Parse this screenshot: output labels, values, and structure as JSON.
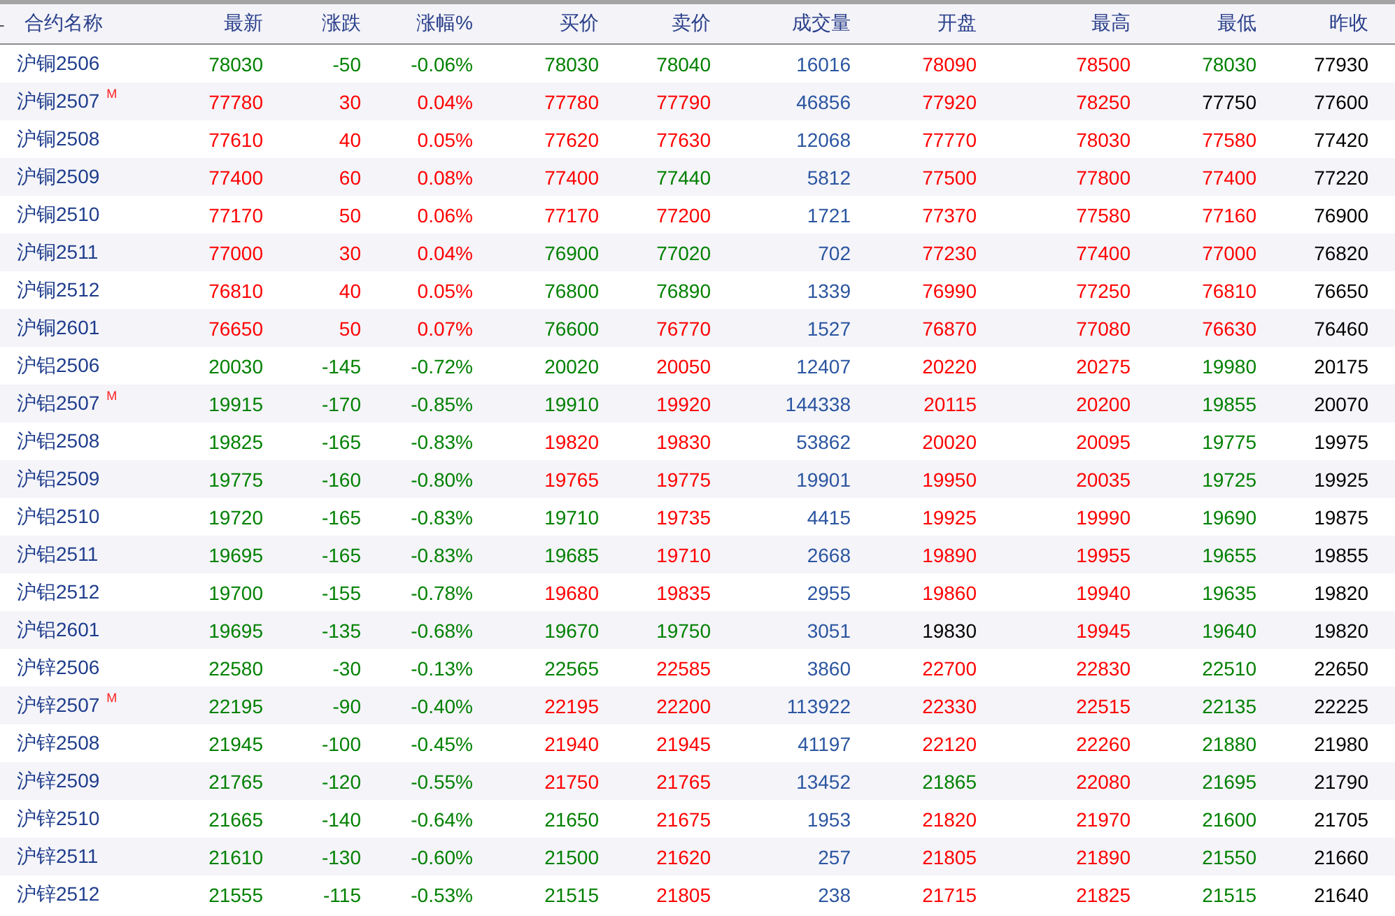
{
  "collapse_toggle": "-",
  "columns": [
    "合约名称",
    "最新",
    "涨跌",
    "涨幅%",
    "买价",
    "卖价",
    "成交量",
    "开盘",
    "最高",
    "最低",
    "昨收"
  ],
  "rows": [
    {
      "name": "沪铜2506",
      "cells": [
        {
          "text": "78030",
          "color": "#008000"
        },
        {
          "text": "-50",
          "color": "#008000"
        },
        {
          "text": "-0.06%",
          "color": "#008000"
        },
        {
          "text": "78030",
          "color": "#008000"
        },
        {
          "text": "78040",
          "color": "#008000"
        },
        {
          "text": "16016",
          "color": "#2b55a0"
        },
        {
          "text": "78090",
          "color": "#ff0000"
        },
        {
          "text": "78500",
          "color": "#ff0000"
        },
        {
          "text": "78030",
          "color": "#008000"
        },
        {
          "text": "77930",
          "color": "#000000"
        }
      ]
    },
    {
      "name": "沪铜2507",
      "mark": "M",
      "cells": [
        {
          "text": "77780",
          "color": "#ff0000"
        },
        {
          "text": "30",
          "color": "#ff0000"
        },
        {
          "text": "0.04%",
          "color": "#ff0000"
        },
        {
          "text": "77780",
          "color": "#ff0000"
        },
        {
          "text": "77790",
          "color": "#ff0000"
        },
        {
          "text": "46856",
          "color": "#2b55a0"
        },
        {
          "text": "77920",
          "color": "#ff0000"
        },
        {
          "text": "78250",
          "color": "#ff0000"
        },
        {
          "text": "77750",
          "color": "#000000"
        },
        {
          "text": "77600",
          "color": "#000000"
        }
      ]
    },
    {
      "name": "沪铜2508",
      "cells": [
        {
          "text": "77610",
          "color": "#ff0000"
        },
        {
          "text": "40",
          "color": "#ff0000"
        },
        {
          "text": "0.05%",
          "color": "#ff0000"
        },
        {
          "text": "77620",
          "color": "#ff0000"
        },
        {
          "text": "77630",
          "color": "#ff0000"
        },
        {
          "text": "12068",
          "color": "#2b55a0"
        },
        {
          "text": "77770",
          "color": "#ff0000"
        },
        {
          "text": "78030",
          "color": "#ff0000"
        },
        {
          "text": "77580",
          "color": "#ff0000"
        },
        {
          "text": "77420",
          "color": "#000000"
        }
      ]
    },
    {
      "name": "沪铜2509",
      "cells": [
        {
          "text": "77400",
          "color": "#ff0000"
        },
        {
          "text": "60",
          "color": "#ff0000"
        },
        {
          "text": "0.08%",
          "color": "#ff0000"
        },
        {
          "text": "77400",
          "color": "#ff0000"
        },
        {
          "text": "77440",
          "color": "#008000"
        },
        {
          "text": "5812",
          "color": "#2b55a0"
        },
        {
          "text": "77500",
          "color": "#ff0000"
        },
        {
          "text": "77800",
          "color": "#ff0000"
        },
        {
          "text": "77400",
          "color": "#ff0000"
        },
        {
          "text": "77220",
          "color": "#000000"
        }
      ]
    },
    {
      "name": "沪铜2510",
      "cells": [
        {
          "text": "77170",
          "color": "#ff0000"
        },
        {
          "text": "50",
          "color": "#ff0000"
        },
        {
          "text": "0.06%",
          "color": "#ff0000"
        },
        {
          "text": "77170",
          "color": "#ff0000"
        },
        {
          "text": "77200",
          "color": "#ff0000"
        },
        {
          "text": "1721",
          "color": "#2b55a0"
        },
        {
          "text": "77370",
          "color": "#ff0000"
        },
        {
          "text": "77580",
          "color": "#ff0000"
        },
        {
          "text": "77160",
          "color": "#ff0000"
        },
        {
          "text": "76900",
          "color": "#000000"
        }
      ]
    },
    {
      "name": "沪铜2511",
      "cells": [
        {
          "text": "77000",
          "color": "#ff0000"
        },
        {
          "text": "30",
          "color": "#ff0000"
        },
        {
          "text": "0.04%",
          "color": "#ff0000"
        },
        {
          "text": "76900",
          "color": "#008000"
        },
        {
          "text": "77020",
          "color": "#008000"
        },
        {
          "text": "702",
          "color": "#2b55a0"
        },
        {
          "text": "77230",
          "color": "#ff0000"
        },
        {
          "text": "77400",
          "color": "#ff0000"
        },
        {
          "text": "77000",
          "color": "#ff0000"
        },
        {
          "text": "76820",
          "color": "#000000"
        }
      ]
    },
    {
      "name": "沪铜2512",
      "cells": [
        {
          "text": "76810",
          "color": "#ff0000"
        },
        {
          "text": "40",
          "color": "#ff0000"
        },
        {
          "text": "0.05%",
          "color": "#ff0000"
        },
        {
          "text": "76800",
          "color": "#008000"
        },
        {
          "text": "76890",
          "color": "#008000"
        },
        {
          "text": "1339",
          "color": "#2b55a0"
        },
        {
          "text": "76990",
          "color": "#ff0000"
        },
        {
          "text": "77250",
          "color": "#ff0000"
        },
        {
          "text": "76810",
          "color": "#ff0000"
        },
        {
          "text": "76650",
          "color": "#000000"
        }
      ]
    },
    {
      "name": "沪铜2601",
      "cells": [
        {
          "text": "76650",
          "color": "#ff0000"
        },
        {
          "text": "50",
          "color": "#ff0000"
        },
        {
          "text": "0.07%",
          "color": "#ff0000"
        },
        {
          "text": "76600",
          "color": "#008000"
        },
        {
          "text": "76770",
          "color": "#ff0000"
        },
        {
          "text": "1527",
          "color": "#2b55a0"
        },
        {
          "text": "76870",
          "color": "#ff0000"
        },
        {
          "text": "77080",
          "color": "#ff0000"
        },
        {
          "text": "76630",
          "color": "#ff0000"
        },
        {
          "text": "76460",
          "color": "#000000"
        }
      ]
    },
    {
      "name": "沪铝2506",
      "cells": [
        {
          "text": "20030",
          "color": "#008000"
        },
        {
          "text": "-145",
          "color": "#008000"
        },
        {
          "text": "-0.72%",
          "color": "#008000"
        },
        {
          "text": "20020",
          "color": "#008000"
        },
        {
          "text": "20050",
          "color": "#ff0000"
        },
        {
          "text": "12407",
          "color": "#2b55a0"
        },
        {
          "text": "20220",
          "color": "#ff0000"
        },
        {
          "text": "20275",
          "color": "#ff0000"
        },
        {
          "text": "19980",
          "color": "#008000"
        },
        {
          "text": "20175",
          "color": "#000000"
        }
      ]
    },
    {
      "name": "沪铝2507",
      "mark": "M",
      "cells": [
        {
          "text": "19915",
          "color": "#008000"
        },
        {
          "text": "-170",
          "color": "#008000"
        },
        {
          "text": "-0.85%",
          "color": "#008000"
        },
        {
          "text": "19910",
          "color": "#008000"
        },
        {
          "text": "19920",
          "color": "#ff0000"
        },
        {
          "text": "144338",
          "color": "#2b55a0"
        },
        {
          "text": "20115",
          "color": "#ff0000"
        },
        {
          "text": "20200",
          "color": "#ff0000"
        },
        {
          "text": "19855",
          "color": "#008000"
        },
        {
          "text": "20070",
          "color": "#000000"
        }
      ]
    },
    {
      "name": "沪铝2508",
      "cells": [
        {
          "text": "19825",
          "color": "#008000"
        },
        {
          "text": "-165",
          "color": "#008000"
        },
        {
          "text": "-0.83%",
          "color": "#008000"
        },
        {
          "text": "19820",
          "color": "#ff0000"
        },
        {
          "text": "19830",
          "color": "#ff0000"
        },
        {
          "text": "53862",
          "color": "#2b55a0"
        },
        {
          "text": "20020",
          "color": "#ff0000"
        },
        {
          "text": "20095",
          "color": "#ff0000"
        },
        {
          "text": "19775",
          "color": "#008000"
        },
        {
          "text": "19975",
          "color": "#000000"
        }
      ]
    },
    {
      "name": "沪铝2509",
      "cells": [
        {
          "text": "19775",
          "color": "#008000"
        },
        {
          "text": "-160",
          "color": "#008000"
        },
        {
          "text": "-0.80%",
          "color": "#008000"
        },
        {
          "text": "19765",
          "color": "#ff0000"
        },
        {
          "text": "19775",
          "color": "#ff0000"
        },
        {
          "text": "19901",
          "color": "#2b55a0"
        },
        {
          "text": "19950",
          "color": "#ff0000"
        },
        {
          "text": "20035",
          "color": "#ff0000"
        },
        {
          "text": "19725",
          "color": "#008000"
        },
        {
          "text": "19925",
          "color": "#000000"
        }
      ]
    },
    {
      "name": "沪铝2510",
      "cells": [
        {
          "text": "19720",
          "color": "#008000"
        },
        {
          "text": "-165",
          "color": "#008000"
        },
        {
          "text": "-0.83%",
          "color": "#008000"
        },
        {
          "text": "19710",
          "color": "#008000"
        },
        {
          "text": "19735",
          "color": "#ff0000"
        },
        {
          "text": "4415",
          "color": "#2b55a0"
        },
        {
          "text": "19925",
          "color": "#ff0000"
        },
        {
          "text": "19990",
          "color": "#ff0000"
        },
        {
          "text": "19690",
          "color": "#008000"
        },
        {
          "text": "19875",
          "color": "#000000"
        }
      ]
    },
    {
      "name": "沪铝2511",
      "cells": [
        {
          "text": "19695",
          "color": "#008000"
        },
        {
          "text": "-165",
          "color": "#008000"
        },
        {
          "text": "-0.83%",
          "color": "#008000"
        },
        {
          "text": "19685",
          "color": "#008000"
        },
        {
          "text": "19710",
          "color": "#ff0000"
        },
        {
          "text": "2668",
          "color": "#2b55a0"
        },
        {
          "text": "19890",
          "color": "#ff0000"
        },
        {
          "text": "19955",
          "color": "#ff0000"
        },
        {
          "text": "19655",
          "color": "#008000"
        },
        {
          "text": "19855",
          "color": "#000000"
        }
      ]
    },
    {
      "name": "沪铝2512",
      "cells": [
        {
          "text": "19700",
          "color": "#008000"
        },
        {
          "text": "-155",
          "color": "#008000"
        },
        {
          "text": "-0.78%",
          "color": "#008000"
        },
        {
          "text": "19680",
          "color": "#ff0000"
        },
        {
          "text": "19835",
          "color": "#ff0000"
        },
        {
          "text": "2955",
          "color": "#2b55a0"
        },
        {
          "text": "19860",
          "color": "#ff0000"
        },
        {
          "text": "19940",
          "color": "#ff0000"
        },
        {
          "text": "19635",
          "color": "#008000"
        },
        {
          "text": "19820",
          "color": "#000000"
        }
      ]
    },
    {
      "name": "沪铝2601",
      "cells": [
        {
          "text": "19695",
          "color": "#008000"
        },
        {
          "text": "-135",
          "color": "#008000"
        },
        {
          "text": "-0.68%",
          "color": "#008000"
        },
        {
          "text": "19670",
          "color": "#008000"
        },
        {
          "text": "19750",
          "color": "#008000"
        },
        {
          "text": "3051",
          "color": "#2b55a0"
        },
        {
          "text": "19830",
          "color": "#000000"
        },
        {
          "text": "19945",
          "color": "#ff0000"
        },
        {
          "text": "19640",
          "color": "#008000"
        },
        {
          "text": "19820",
          "color": "#000000"
        }
      ]
    },
    {
      "name": "沪锌2506",
      "cells": [
        {
          "text": "22580",
          "color": "#008000"
        },
        {
          "text": "-30",
          "color": "#008000"
        },
        {
          "text": "-0.13%",
          "color": "#008000"
        },
        {
          "text": "22565",
          "color": "#008000"
        },
        {
          "text": "22585",
          "color": "#ff0000"
        },
        {
          "text": "3860",
          "color": "#2b55a0"
        },
        {
          "text": "22700",
          "color": "#ff0000"
        },
        {
          "text": "22830",
          "color": "#ff0000"
        },
        {
          "text": "22510",
          "color": "#008000"
        },
        {
          "text": "22650",
          "color": "#000000"
        }
      ]
    },
    {
      "name": "沪锌2507",
      "mark": "M",
      "cells": [
        {
          "text": "22195",
          "color": "#008000"
        },
        {
          "text": "-90",
          "color": "#008000"
        },
        {
          "text": "-0.40%",
          "color": "#008000"
        },
        {
          "text": "22195",
          "color": "#ff0000"
        },
        {
          "text": "22200",
          "color": "#ff0000"
        },
        {
          "text": "113922",
          "color": "#2b55a0"
        },
        {
          "text": "22330",
          "color": "#ff0000"
        },
        {
          "text": "22515",
          "color": "#ff0000"
        },
        {
          "text": "22135",
          "color": "#008000"
        },
        {
          "text": "22225",
          "color": "#000000"
        }
      ]
    },
    {
      "name": "沪锌2508",
      "cells": [
        {
          "text": "21945",
          "color": "#008000"
        },
        {
          "text": "-100",
          "color": "#008000"
        },
        {
          "text": "-0.45%",
          "color": "#008000"
        },
        {
          "text": "21940",
          "color": "#ff0000"
        },
        {
          "text": "21945",
          "color": "#ff0000"
        },
        {
          "text": "41197",
          "color": "#2b55a0"
        },
        {
          "text": "22120",
          "color": "#ff0000"
        },
        {
          "text": "22260",
          "color": "#ff0000"
        },
        {
          "text": "21880",
          "color": "#008000"
        },
        {
          "text": "21980",
          "color": "#000000"
        }
      ]
    },
    {
      "name": "沪锌2509",
      "cells": [
        {
          "text": "21765",
          "color": "#008000"
        },
        {
          "text": "-120",
          "color": "#008000"
        },
        {
          "text": "-0.55%",
          "color": "#008000"
        },
        {
          "text": "21750",
          "color": "#ff0000"
        },
        {
          "text": "21765",
          "color": "#ff0000"
        },
        {
          "text": "13452",
          "color": "#2b55a0"
        },
        {
          "text": "21865",
          "color": "#008000"
        },
        {
          "text": "22080",
          "color": "#ff0000"
        },
        {
          "text": "21695",
          "color": "#008000"
        },
        {
          "text": "21790",
          "color": "#000000"
        }
      ]
    },
    {
      "name": "沪锌2510",
      "cells": [
        {
          "text": "21665",
          "color": "#008000"
        },
        {
          "text": "-140",
          "color": "#008000"
        },
        {
          "text": "-0.64%",
          "color": "#008000"
        },
        {
          "text": "21650",
          "color": "#008000"
        },
        {
          "text": "21675",
          "color": "#ff0000"
        },
        {
          "text": "1953",
          "color": "#2b55a0"
        },
        {
          "text": "21820",
          "color": "#ff0000"
        },
        {
          "text": "21970",
          "color": "#ff0000"
        },
        {
          "text": "21600",
          "color": "#008000"
        },
        {
          "text": "21705",
          "color": "#000000"
        }
      ]
    },
    {
      "name": "沪锌2511",
      "cells": [
        {
          "text": "21610",
          "color": "#008000"
        },
        {
          "text": "-130",
          "color": "#008000"
        },
        {
          "text": "-0.60%",
          "color": "#008000"
        },
        {
          "text": "21500",
          "color": "#008000"
        },
        {
          "text": "21620",
          "color": "#ff0000"
        },
        {
          "text": "257",
          "color": "#2b55a0"
        },
        {
          "text": "21805",
          "color": "#ff0000"
        },
        {
          "text": "21890",
          "color": "#ff0000"
        },
        {
          "text": "21550",
          "color": "#008000"
        },
        {
          "text": "21660",
          "color": "#000000"
        }
      ]
    },
    {
      "name": "沪锌2512",
      "cells": [
        {
          "text": "21555",
          "color": "#008000"
        },
        {
          "text": "-115",
          "color": "#008000"
        },
        {
          "text": "-0.53%",
          "color": "#008000"
        },
        {
          "text": "21515",
          "color": "#008000"
        },
        {
          "text": "21805",
          "color": "#ff0000"
        },
        {
          "text": "238",
          "color": "#2b55a0"
        },
        {
          "text": "21715",
          "color": "#ff0000"
        },
        {
          "text": "21825",
          "color": "#ff0000"
        },
        {
          "text": "21515",
          "color": "#008000"
        },
        {
          "text": "21640",
          "color": "#000000"
        }
      ]
    }
  ]
}
